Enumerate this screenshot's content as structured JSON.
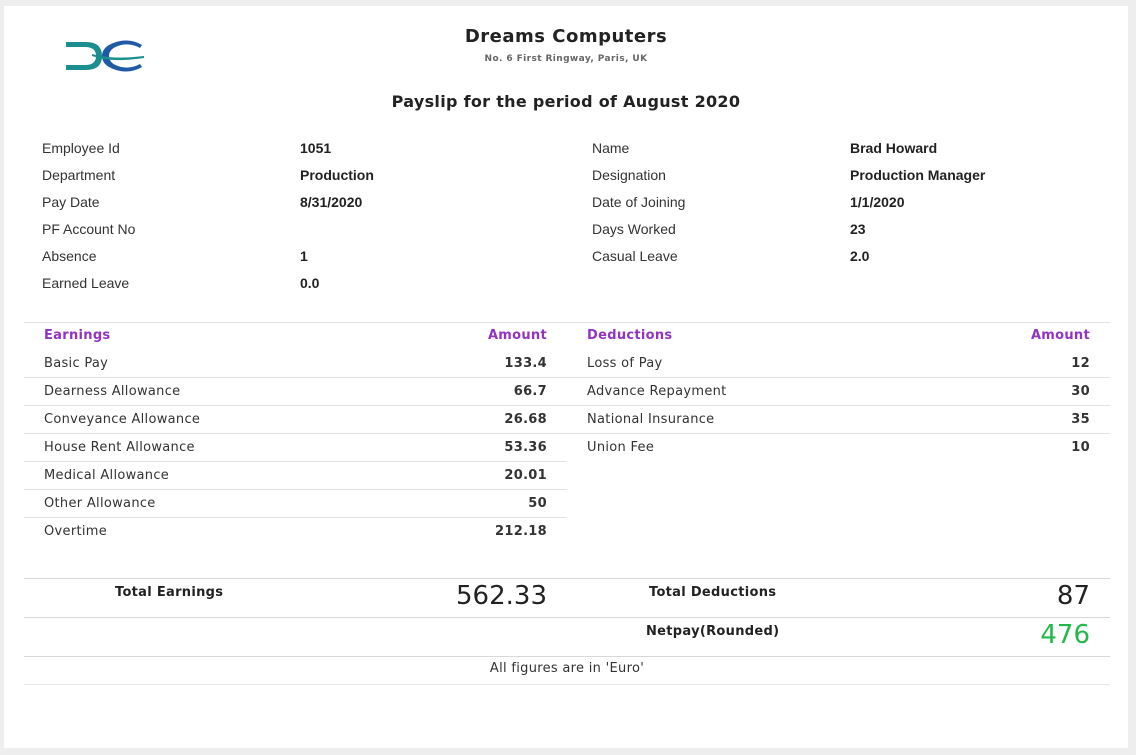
{
  "header": {
    "logo_icon": "dc-logo-icon",
    "company": "Dreams Computers",
    "address": "No. 6 First Ringway, Paris, UK",
    "period_title": "Payslip for the period of August 2020"
  },
  "employee": {
    "left": [
      {
        "label": "Employee Id",
        "value": "1051"
      },
      {
        "label": "Department",
        "value": "Production"
      },
      {
        "label": "Pay Date",
        "value": "8/31/2020"
      },
      {
        "label": "PF Account No",
        "value": ""
      },
      {
        "label": "Absence",
        "value": "1"
      },
      {
        "label": "Earned Leave",
        "value": "0.0"
      }
    ],
    "right": [
      {
        "label": "Name",
        "value": "Brad Howard"
      },
      {
        "label": "Designation",
        "value": "Production Manager"
      },
      {
        "label": "Date of Joining",
        "value": "1/1/2020"
      },
      {
        "label": "Days Worked",
        "value": "23"
      },
      {
        "label": "Casual Leave",
        "value": "2.0"
      }
    ]
  },
  "earnings": {
    "header_label": "Earnings",
    "header_amount": "Amount",
    "rows": [
      {
        "label": "Basic Pay",
        "amount": "133.4"
      },
      {
        "label": "Dearness Allowance",
        "amount": "66.7"
      },
      {
        "label": "Conveyance Allowance",
        "amount": "26.68"
      },
      {
        "label": "House Rent Allowance",
        "amount": "53.36"
      },
      {
        "label": "Medical Allowance",
        "amount": "20.01"
      },
      {
        "label": "Other Allowance",
        "amount": "50"
      },
      {
        "label": "Overtime",
        "amount": "212.18"
      }
    ]
  },
  "deductions": {
    "header_label": "Deductions",
    "header_amount": "Amount",
    "rows": [
      {
        "label": "Loss of Pay",
        "amount": "12"
      },
      {
        "label": "Advance Repayment",
        "amount": "30"
      },
      {
        "label": "National Insurance",
        "amount": "35"
      },
      {
        "label": "Union Fee",
        "amount": "10"
      }
    ]
  },
  "totals": {
    "earnings_label": "Total Earnings",
    "earnings_value": "562.33",
    "deductions_label": "Total Deductions",
    "deductions_value": "87",
    "netpay_label": "Netpay(Rounded)",
    "netpay_value": "476"
  },
  "footer_note": "All figures are in 'Euro'",
  "colors": {
    "accent": "#9333c2",
    "netpay": "#22b84a",
    "logo_teal": "#1d8e8e",
    "logo_blue": "#1f5aa8"
  }
}
